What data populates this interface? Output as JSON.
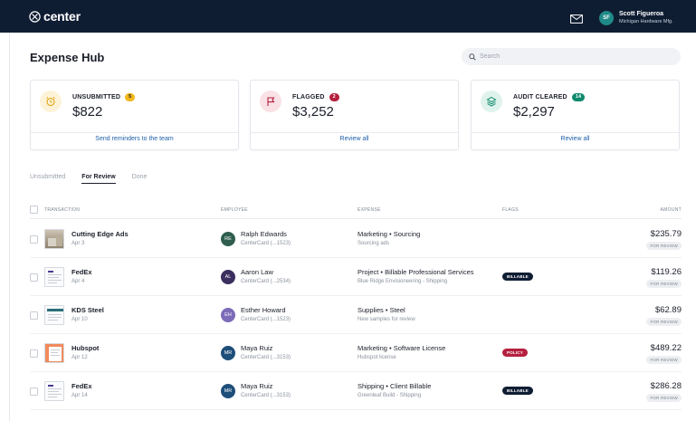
{
  "app": {
    "logo_text": "center"
  },
  "user": {
    "initials": "SF",
    "name": "Scott Figueroa",
    "org": "Michigan Hardware Mfg."
  },
  "page": {
    "title": "Expense Hub"
  },
  "search": {
    "placeholder": "Search",
    "value": ""
  },
  "summary_cards": [
    {
      "label": "UNSUBMITTED",
      "count": "5",
      "amount": "$822",
      "action": "Send reminders to the team",
      "badge_color": "#f2b81c",
      "icon": "alarm-clock-icon",
      "icon_bg": "#fdf3d9",
      "icon_color": "#e0a30e"
    },
    {
      "label": "FLAGGED",
      "count": "2",
      "amount": "$3,252",
      "action": "Review all",
      "badge_color": "#b5203f",
      "icon": "flag-icon",
      "icon_bg": "#f9e1e5",
      "icon_color": "#b5203f"
    },
    {
      "label": "AUDIT CLEARED",
      "count": "14",
      "amount": "$2,297",
      "action": "Review all",
      "badge_color": "#0f8a6c",
      "icon": "layers-icon",
      "icon_bg": "#dff3ec",
      "icon_color": "#0f8a6c"
    }
  ],
  "tabs": [
    {
      "label": "Unsubmitted",
      "active": false
    },
    {
      "label": "For Review",
      "active": true
    },
    {
      "label": "Done",
      "active": false
    }
  ],
  "table": {
    "columns": [
      "TRANSACTION",
      "EMPLOYEE",
      "EXPENSE",
      "FLAGS",
      "AMOUNT"
    ],
    "rows": [
      {
        "merchant": "Cutting Edge Ads",
        "date": "Apr 3",
        "emp_initials": "RE",
        "emp_color": "#2f5e4e",
        "employee": "Ralph Edwards",
        "card": "CenterCard (...1523)",
        "expense": "Marketing • Sourcing",
        "note": "Sourcing ads",
        "flag": "",
        "amount": "$235.79",
        "status": "FOR REVIEW"
      },
      {
        "merchant": "FedEx",
        "date": "Apr 4",
        "emp_initials": "AL",
        "emp_color": "#3a2f5e",
        "employee": "Aaron Law",
        "card": "CenterCard (...2534)",
        "expense": "Project • Billable Professional Services",
        "note": "Blue Ridge Envisioneering - Shipping",
        "flag": "BILLABLE",
        "amount": "$119.26",
        "status": "FOR REVIEW"
      },
      {
        "merchant": "KDS Steel",
        "date": "Apr 10",
        "emp_initials": "EH",
        "emp_color": "#7b6bb8",
        "employee": "Esther Howard",
        "card": "CenterCard (...1523)",
        "expense": "Supplies • Steel",
        "note": "New samples for review",
        "flag": "",
        "amount": "$62.89",
        "status": "FOR REVIEW"
      },
      {
        "merchant": "Hubspot",
        "date": "Apr 12",
        "emp_initials": "MR",
        "emp_color": "#1e4e7a",
        "employee": "Maya Ruiz",
        "card": "CenterCard (...3153)",
        "expense": "Marketing • Software License",
        "note": "Hubspot license",
        "flag": "POLICY",
        "amount": "$489.22",
        "status": "FOR REVIEW"
      },
      {
        "merchant": "FedEx",
        "date": "Apr 14",
        "emp_initials": "MR",
        "emp_color": "#1e4e7a",
        "employee": "Maya Ruiz",
        "card": "CenterCard (...3153)",
        "expense": "Shipping • Client Billable",
        "note": "Greenleaf Build - Shipping",
        "flag": "BILLABLE",
        "amount": "$286.28",
        "status": "FOR REVIEW"
      }
    ]
  }
}
